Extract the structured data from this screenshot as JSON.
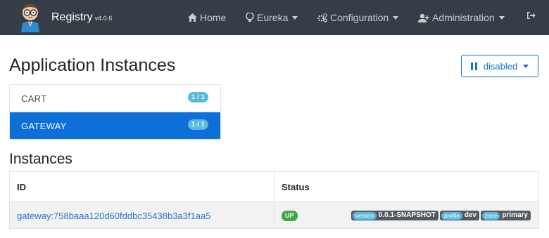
{
  "navbar": {
    "brand": "Registry",
    "version": "v4.0.6",
    "items": [
      {
        "label": "Home",
        "icon": "home-icon"
      },
      {
        "label": "Eureka",
        "icon": "lightbulb-icon"
      },
      {
        "label": "Configuration",
        "icon": "cogs-icon"
      },
      {
        "label": "Administration",
        "icon": "user-plus-icon"
      }
    ],
    "logout_icon": "sign-out-icon"
  },
  "page": {
    "title": "Application Instances",
    "refresh_button": "disabled"
  },
  "applications": [
    {
      "name": "CART",
      "count": "1 / 1",
      "active": false
    },
    {
      "name": "GATEWAY",
      "count": "1 / 1",
      "active": true
    }
  ],
  "instances": {
    "title": "Instances",
    "columns": [
      "ID",
      "Status"
    ],
    "rows": [
      {
        "id": "gateway:758baaa120d60fddbc35438b3a3f1aa5",
        "status": "UP",
        "metadata": [
          {
            "key": "version",
            "value": "0.0.1-SNAPSHOT"
          },
          {
            "key": "profile",
            "value": "dev"
          },
          {
            "key": "zone",
            "value": "primary"
          }
        ]
      }
    ]
  },
  "colors": {
    "navbar": "#353d47",
    "primary": "#0d6fd8",
    "info": "#5bb9dd",
    "success": "#3da84a"
  }
}
